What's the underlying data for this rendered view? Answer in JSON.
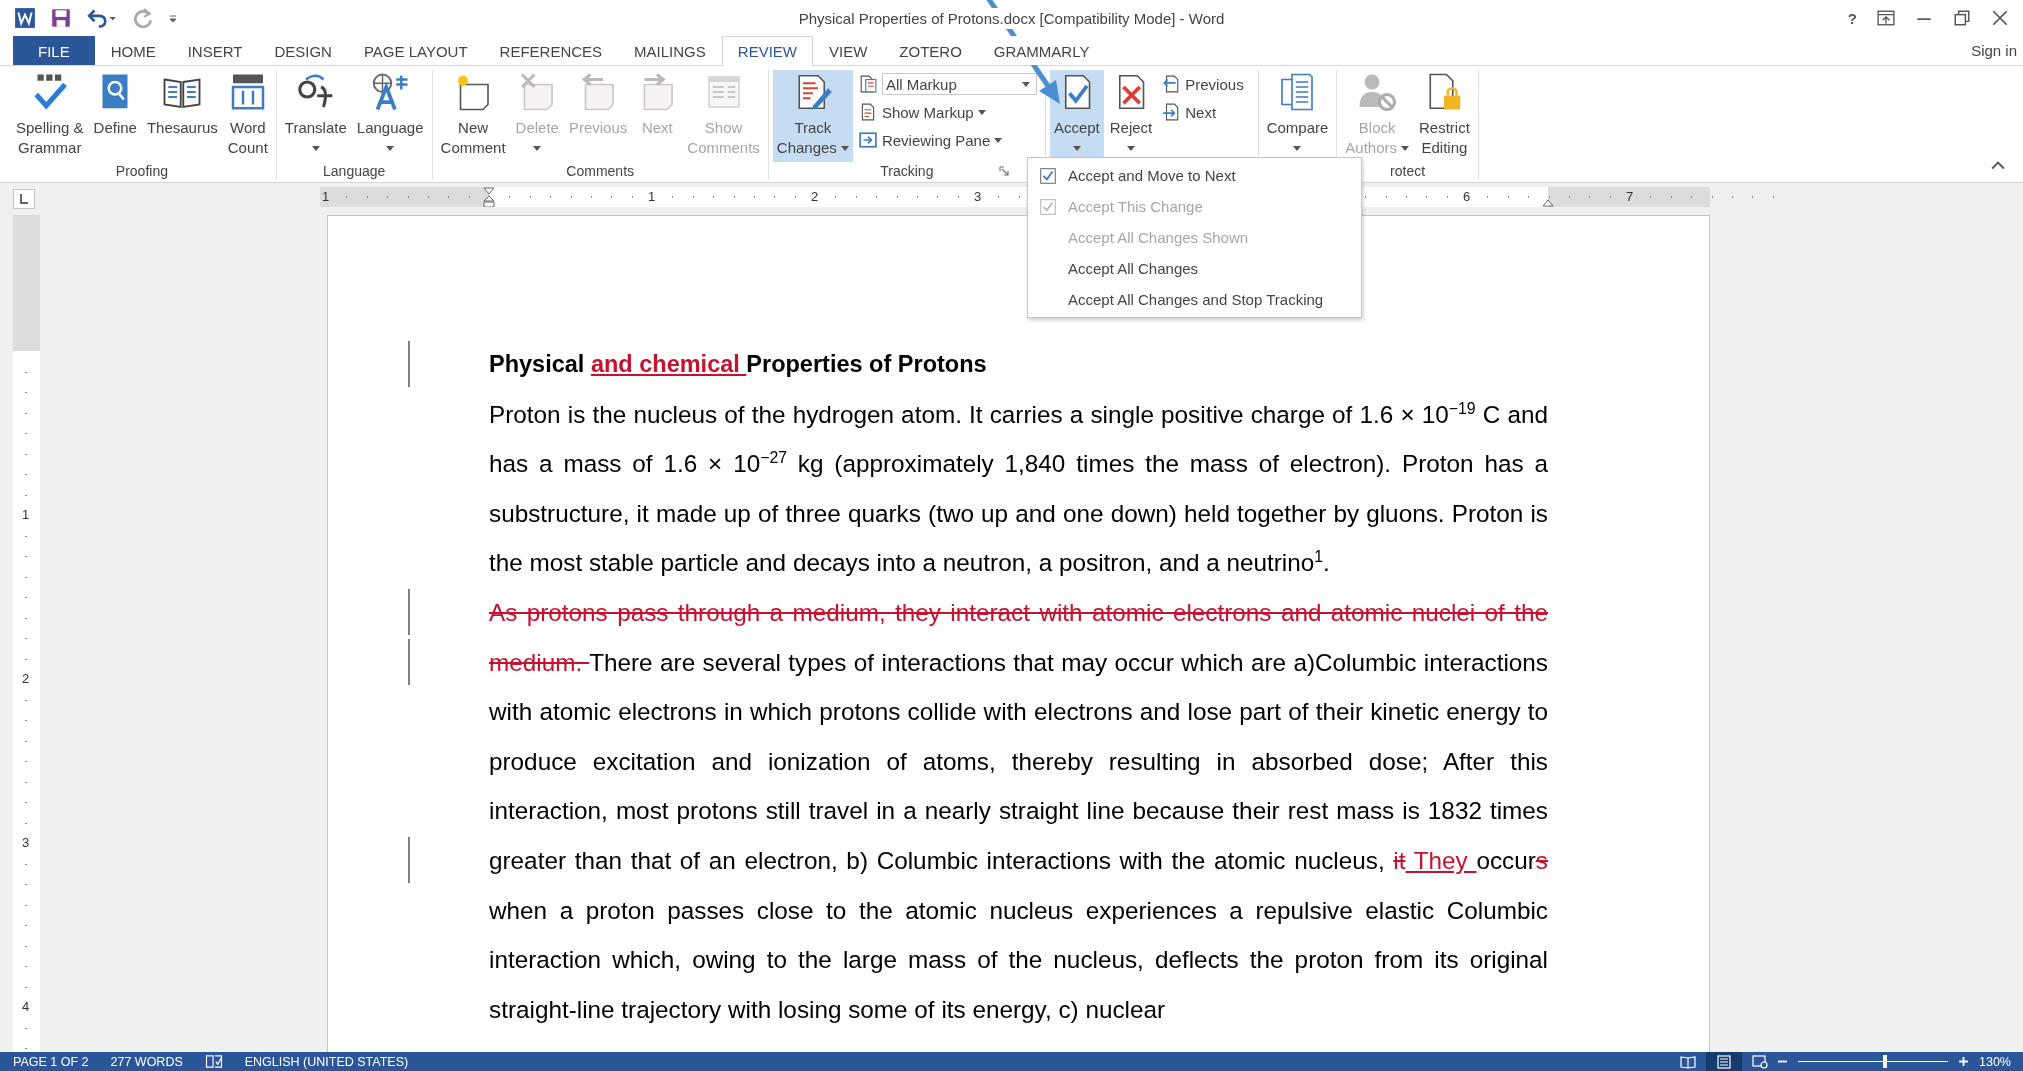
{
  "window": {
    "title": "Physical Properties of Protons.docx [Compatibility Mode] - Word",
    "help": "?",
    "sign_in": "Sign in"
  },
  "tabs": [
    {
      "label": "FILE",
      "kind": "file",
      "selected": false
    },
    {
      "label": "HOME",
      "kind": "tab",
      "selected": false
    },
    {
      "label": "INSERT",
      "kind": "tab",
      "selected": false
    },
    {
      "label": "DESIGN",
      "kind": "tab",
      "selected": false
    },
    {
      "label": "PAGE LAYOUT",
      "kind": "tab",
      "selected": false
    },
    {
      "label": "REFERENCES",
      "kind": "tab",
      "selected": false
    },
    {
      "label": "MAILINGS",
      "kind": "tab",
      "selected": false
    },
    {
      "label": "REVIEW",
      "kind": "tab",
      "selected": true
    },
    {
      "label": "VIEW",
      "kind": "tab",
      "selected": false
    },
    {
      "label": "ZOTERO",
      "kind": "tab",
      "selected": false
    },
    {
      "label": "GRAMMARLY",
      "kind": "tab",
      "selected": false
    }
  ],
  "ribbon": {
    "groups": [
      {
        "label": "Proofing",
        "launcher": false,
        "large": [
          {
            "label": [
              "Spelling &",
              "Grammar"
            ],
            "disabled": false,
            "selected": false,
            "dropdown": false
          },
          {
            "label": [
              "Define"
            ],
            "disabled": false,
            "selected": false,
            "dropdown": false
          },
          {
            "label": [
              "Thesaurus"
            ],
            "disabled": false,
            "selected": false,
            "dropdown": false
          },
          {
            "label": [
              "Word",
              "Count"
            ],
            "disabled": false,
            "selected": false,
            "dropdown": false
          }
        ]
      },
      {
        "label": "Language",
        "launcher": false,
        "large": [
          {
            "label": [
              "Translate"
            ],
            "disabled": false,
            "selected": false,
            "dropdown": true
          },
          {
            "label": [
              "Language"
            ],
            "disabled": false,
            "selected": false,
            "dropdown": true
          }
        ]
      },
      {
        "label": "Comments",
        "launcher": false,
        "large": [
          {
            "label": [
              "New",
              "Comment"
            ],
            "disabled": false,
            "selected": false,
            "dropdown": false
          },
          {
            "label": [
              "Delete"
            ],
            "disabled": true,
            "selected": false,
            "dropdown": true
          },
          {
            "label": [
              "Previous"
            ],
            "disabled": true,
            "selected": false,
            "dropdown": false
          },
          {
            "label": [
              "Next"
            ],
            "disabled": true,
            "selected": false,
            "dropdown": false
          },
          {
            "label": [
              "Show",
              "Comments"
            ],
            "disabled": true,
            "selected": false,
            "dropdown": false
          }
        ]
      },
      {
        "label": "Tracking",
        "launcher": true,
        "large": [
          {
            "label": [
              "Track",
              "Changes"
            ],
            "disabled": false,
            "selected": true,
            "dropdown": true
          }
        ],
        "small": [
          {
            "kind": "select",
            "label": "All Markup",
            "dropdown": true
          },
          {
            "kind": "button",
            "label": "Show Markup",
            "dropdown": true
          },
          {
            "kind": "button",
            "label": "Reviewing Pane",
            "dropdown": true
          }
        ]
      },
      {
        "launcher": false,
        "large": [
          {
            "label": [
              "Accept"
            ],
            "disabled": false,
            "selected": true,
            "dropdown": true
          },
          {
            "label": [
              "Reject"
            ],
            "disabled": false,
            "selected": false,
            "dropdown": true
          }
        ],
        "small": [
          {
            "kind": "button",
            "label": "Previous",
            "dropdown": false
          },
          {
            "kind": "button",
            "label": "Next",
            "dropdown": false
          }
        ]
      },
      {
        "launcher": false,
        "large": [
          {
            "label": [
              "Compare"
            ],
            "disabled": false,
            "selected": false,
            "dropdown": true
          }
        ]
      },
      {
        "label": "rotect",
        "launcher": false,
        "large": [
          {
            "label": [
              "Block",
              "Authors"
            ],
            "disabled": true,
            "selected": false,
            "dropdown": true
          },
          {
            "label": [
              "Restrict",
              "Editing"
            ],
            "disabled": false,
            "selected": false,
            "dropdown": false
          }
        ]
      }
    ]
  },
  "accept_menu": {
    "items": [
      {
        "label": "Accept and Move to Next",
        "kind": "icon",
        "disabled": false
      },
      {
        "label": "Accept This Change",
        "kind": "icon",
        "disabled": true
      },
      {
        "label": "Accept All Changes Shown",
        "kind": "text",
        "disabled": true
      },
      {
        "label": "Accept All Changes",
        "kind": "text",
        "disabled": false
      },
      {
        "label": "Accept All Changes and Stop Tracking",
        "kind": "text",
        "disabled": false
      }
    ]
  },
  "rulers": {
    "horizontal": [
      "1",
      "1",
      "2",
      "3",
      "6",
      "7"
    ],
    "vertical": [
      "1",
      "2",
      "3",
      "4"
    ]
  },
  "document": {
    "paragraphs": [
      {
        "kind": "heading",
        "segments": [
          {
            "kind": "plain",
            "text": "Physical ",
            "bar": false
          },
          {
            "kind": "inserted",
            "text": "and chemical ",
            "bar": true
          },
          {
            "kind": "plain",
            "text": "Properties of Protons",
            "bar": false
          }
        ]
      },
      {
        "kind": "body",
        "segments": [
          {
            "kind": "plain",
            "text": "Proton is the nucleus of the hydrogen atom. It carries a single positive charge of 1.6 × 10$^{−19}$ C and has a mass of 1.6 × 10$^{−27}$ kg (approximately 1,840 times the mass of electron). Proton has a substructure, it made up of three quarks (two up and one down) held together by gluons. Proton is the most stable particle and decays into a neutron, a positron, and a neutrino$^{1}$.",
            "bar": false
          }
        ]
      },
      {
        "kind": "body",
        "segments": [
          {
            "kind": "deleted",
            "text": "As protons pass through a medium, they interact with atomic electrons and atomic nuclei of the ",
            "bar": true
          },
          {
            "kind": "deleted",
            "text": "medium. ",
            "bar": true
          },
          {
            "kind": "plain",
            "text": "There are several types of interactions that may occur which are a)Columbic interactions with atomic electrons in which protons collide with electrons and lose part of their kinetic energy to produce excitation and ionization of atoms, thereby resulting in absorbed dose; After this interaction, most protons still travel in a nearly straight line because their rest mass is 1832 times greater than that of an electron, b) Columbic interactions with the atomic nucleus, ",
            "bar": false
          },
          {
            "kind": "deleted",
            "text": "it",
            "bar": true
          },
          {
            "kind": "inserted",
            "text": " They ",
            "bar": false
          },
          {
            "kind": "plain",
            "text": "occur",
            "bar": false
          },
          {
            "kind": "deleted",
            "text": "s",
            "bar": false
          },
          {
            "kind": "plain",
            "text": " when a proton passes close to the atomic nucleus experiences a repulsive elastic Columbic interaction which, owing to the large mass of the nucleus, deflects the proton from its original straight-line trajectory with losing some of its energy, c) nuclear",
            "bar": false
          }
        ]
      }
    ]
  },
  "status_bar": {
    "page": "PAGE 1 OF 2",
    "words": "277 WORDS",
    "language": "ENGLISH (UNITED STATES)",
    "views": [
      {
        "selected": false
      },
      {
        "selected": true
      },
      {
        "selected": false
      }
    ],
    "zoom": {
      "level": 0.58,
      "reading": "130%"
    }
  }
}
